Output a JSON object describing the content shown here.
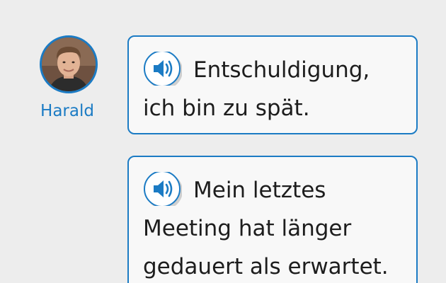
{
  "speaker": {
    "name": "Harald",
    "avatar_icon": "person-photo-icon"
  },
  "messages": [
    {
      "audio_icon": "speaker-audio-icon",
      "text": "Entschuldigung, ich bin zu spät."
    },
    {
      "audio_icon": "speaker-audio-icon",
      "text": "Mein letztes Meeting hat länger gedauert als erwartet."
    }
  ],
  "colors": {
    "accent": "#1b7bc4",
    "background": "#ededed",
    "bubble_background": "#f8f8f8",
    "text": "#1d1d1d"
  }
}
